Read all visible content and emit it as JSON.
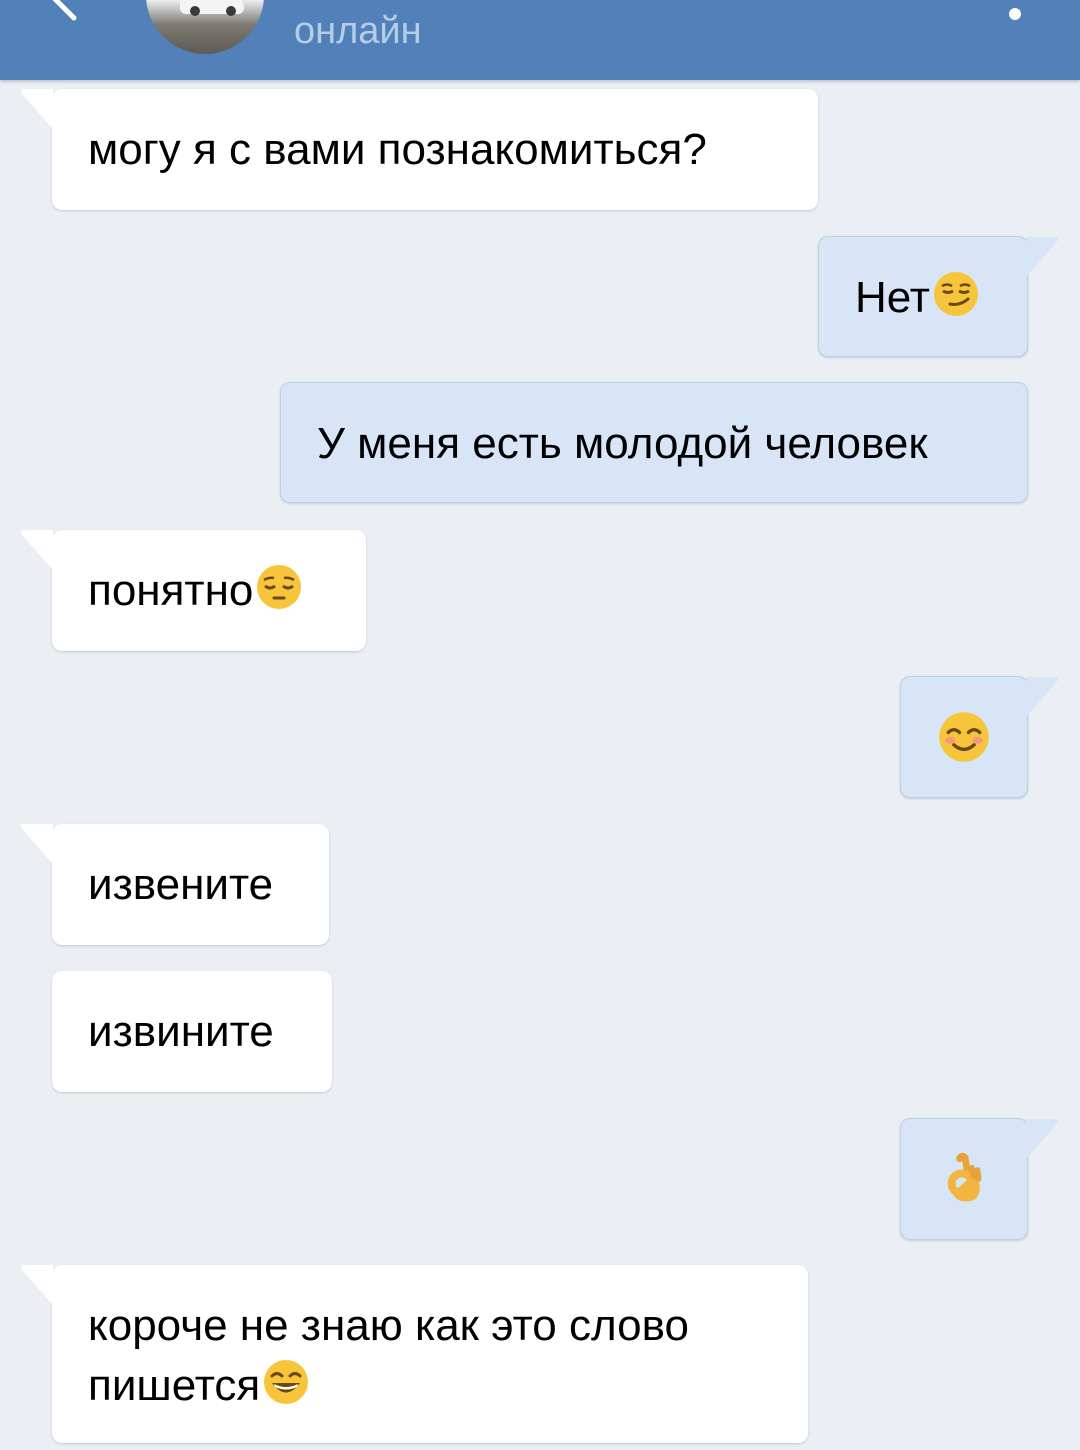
{
  "header": {
    "status": "онлайн",
    "back_icon": "back-arrow-icon",
    "menu_icon": "more-vertical-icon",
    "bg_color": "#5181b8"
  },
  "colors": {
    "incoming_bubble": "#ffffff",
    "outgoing_bubble": "#d7e5f6",
    "chat_background": "#ebeff4"
  },
  "messages": [
    {
      "direction": "incoming",
      "text": "могу я с вами познакомиться?",
      "emoji": ""
    },
    {
      "direction": "outgoing",
      "text": "Нет",
      "emoji": "smirking-face-emoji"
    },
    {
      "direction": "outgoing",
      "text": "У меня есть молодой человек",
      "emoji": ""
    },
    {
      "direction": "incoming",
      "text": "понятно",
      "emoji": "pensive-face-emoji"
    },
    {
      "direction": "outgoing",
      "text": "",
      "emoji": "smiling-face-emoji"
    },
    {
      "direction": "incoming",
      "text": "извените",
      "emoji": ""
    },
    {
      "direction": "incoming",
      "text": "извините",
      "emoji": ""
    },
    {
      "direction": "outgoing",
      "text": "",
      "emoji": "ok-hand-emoji"
    },
    {
      "direction": "incoming",
      "text": "короче не знаю как это слово пишется",
      "emoji": "grinning-face-emoji"
    }
  ]
}
